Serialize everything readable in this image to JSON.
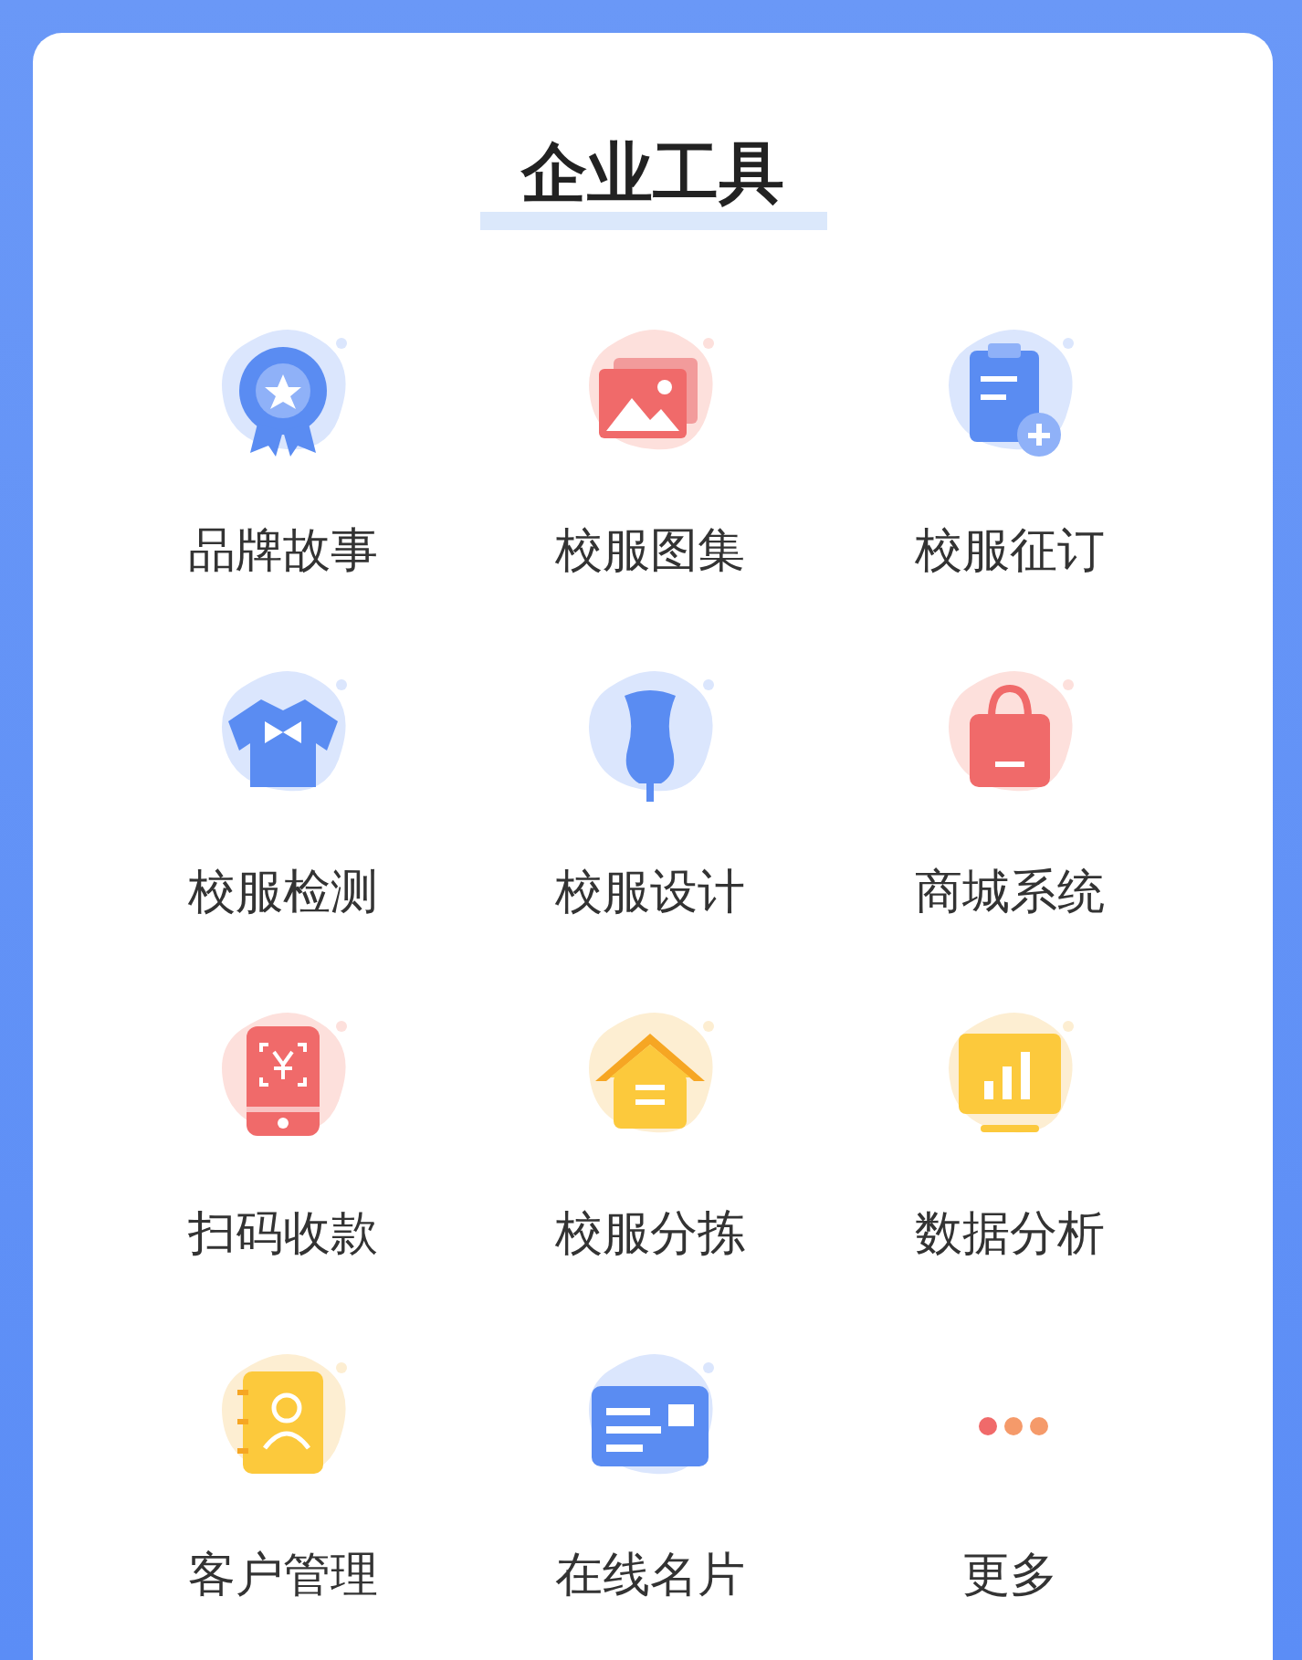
{
  "title": "企业工具",
  "tools": [
    {
      "label": "品牌故事"
    },
    {
      "label": "校服图集"
    },
    {
      "label": "校服征订"
    },
    {
      "label": "校服检测"
    },
    {
      "label": "校服设计"
    },
    {
      "label": "商城系统"
    },
    {
      "label": "扫码收款"
    },
    {
      "label": "校服分拣"
    },
    {
      "label": "数据分析"
    },
    {
      "label": "客户管理"
    },
    {
      "label": "在线名片"
    },
    {
      "label": "更多"
    }
  ]
}
